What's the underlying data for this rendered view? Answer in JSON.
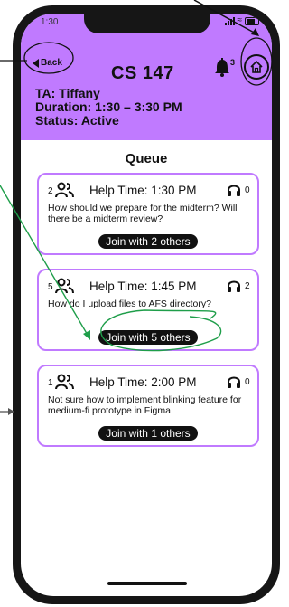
{
  "status_bar": {
    "time": "1:30"
  },
  "header": {
    "back_label": "Back",
    "course": "CS 147",
    "notification_count": "3",
    "ta": "TA: Tiffany",
    "duration": "Duration: 1:30 – 3:30 PM",
    "status": "Status: Active",
    "bg_color": "#c07aff"
  },
  "queue": {
    "title": "Queue",
    "items": [
      {
        "count": "2",
        "help_time": "Help Time: 1:30 PM",
        "listeners": "0",
        "question": "How should we prepare for the midterm? Will there be a midterm review?",
        "join_label": "Join with 2 others"
      },
      {
        "count": "5",
        "help_time": "Help Time: 1:45 PM",
        "listeners": "2",
        "question": "How do I upload files to AFS directory?",
        "join_label": "Join with 5 others"
      },
      {
        "count": "1",
        "help_time": "Help Time: 2:00 PM",
        "listeners": "0",
        "question": "Not sure how to implement blinking feature for medium-fi prototype in Figma.",
        "join_label": "Join with 1 others"
      }
    ]
  },
  "icons": [
    "back-arrow-icon",
    "bell-icon",
    "home-icon",
    "people-icon",
    "headphones-icon",
    "signal-icon",
    "wifi-icon",
    "battery-icon"
  ],
  "colors": {
    "accent": "#c07aff",
    "annotation_green": "#1f9e4a",
    "button_dark": "#111111"
  }
}
